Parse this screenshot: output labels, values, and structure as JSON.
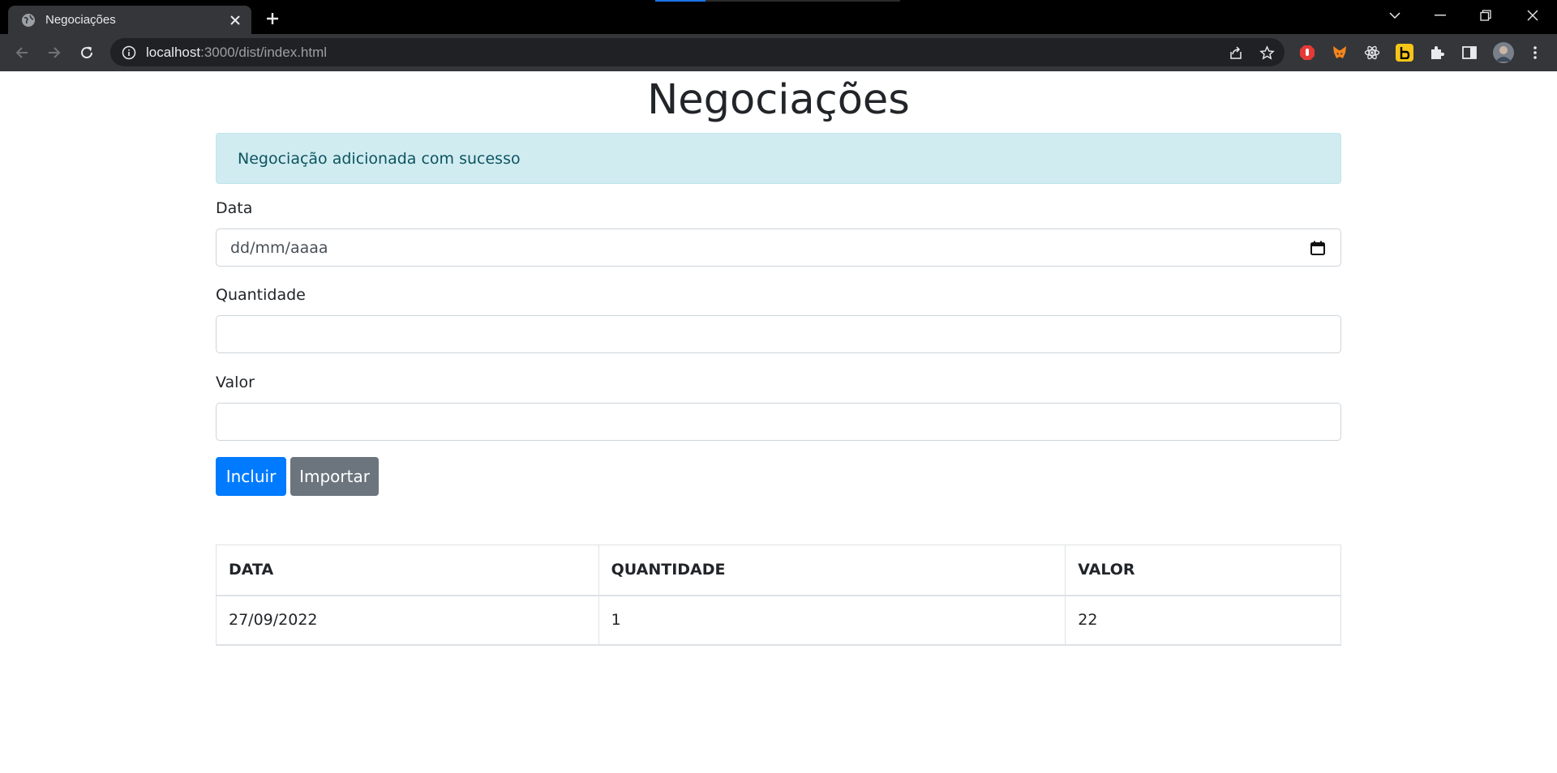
{
  "browser": {
    "tab_title": "Negociações",
    "url_host": "localhost",
    "url_path": ":3000/dist/index.html"
  },
  "page": {
    "heading": "Negociações",
    "alert_message": "Negociação adicionada com sucesso",
    "form": {
      "data_label": "Data",
      "data_placeholder": "dd/mm/aaaa",
      "quantidade_label": "Quantidade",
      "quantidade_value": "",
      "valor_label": "Valor",
      "valor_value": "",
      "incluir_label": "Incluir",
      "importar_label": "Importar"
    },
    "table": {
      "headers": [
        "DATA",
        "QUANTIDADE",
        "VALOR"
      ],
      "rows": [
        [
          "27/09/2022",
          "1",
          "22"
        ]
      ]
    }
  },
  "colors": {
    "primary": "#007bff",
    "secondary": "#6c757d",
    "alert_bg": "#d1ecf1",
    "alert_text": "#0c5460"
  }
}
